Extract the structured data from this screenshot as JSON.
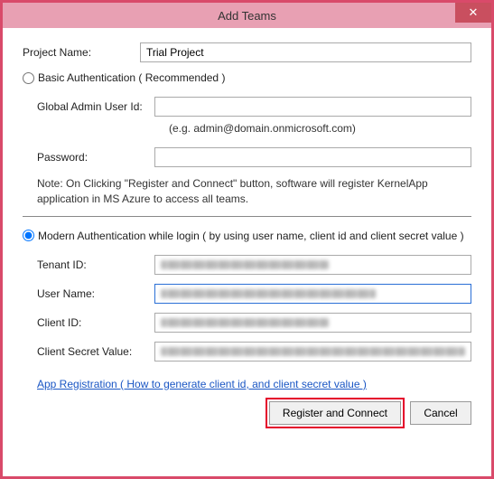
{
  "window": {
    "title": "Add Teams",
    "close_icon": "✕"
  },
  "project": {
    "label": "Project Name:",
    "value": "Trial Project"
  },
  "basic": {
    "radio_label": "Basic Authentication ( Recommended )",
    "globalAdmin": {
      "label": "Global Admin User Id:",
      "hint": "(e.g. admin@domain.onmicrosoft.com)",
      "value": ""
    },
    "password": {
      "label": "Password:",
      "value": ""
    },
    "note": "Note: On Clicking \"Register and Connect\" button, software will register KernelApp application in MS Azure to access all teams."
  },
  "modern": {
    "radio_label": "Modern Authentication while login ( by using user name, client id and client secret value )",
    "tenantId": {
      "label": "Tenant ID:"
    },
    "userName": {
      "label": "User Name:"
    },
    "clientId": {
      "label": "Client ID:"
    },
    "clientSecret": {
      "label": "Client Secret Value:"
    },
    "link": "App Registration ( How to generate client id, and client secret value )"
  },
  "buttons": {
    "register": "Register and Connect",
    "cancel": "Cancel"
  }
}
